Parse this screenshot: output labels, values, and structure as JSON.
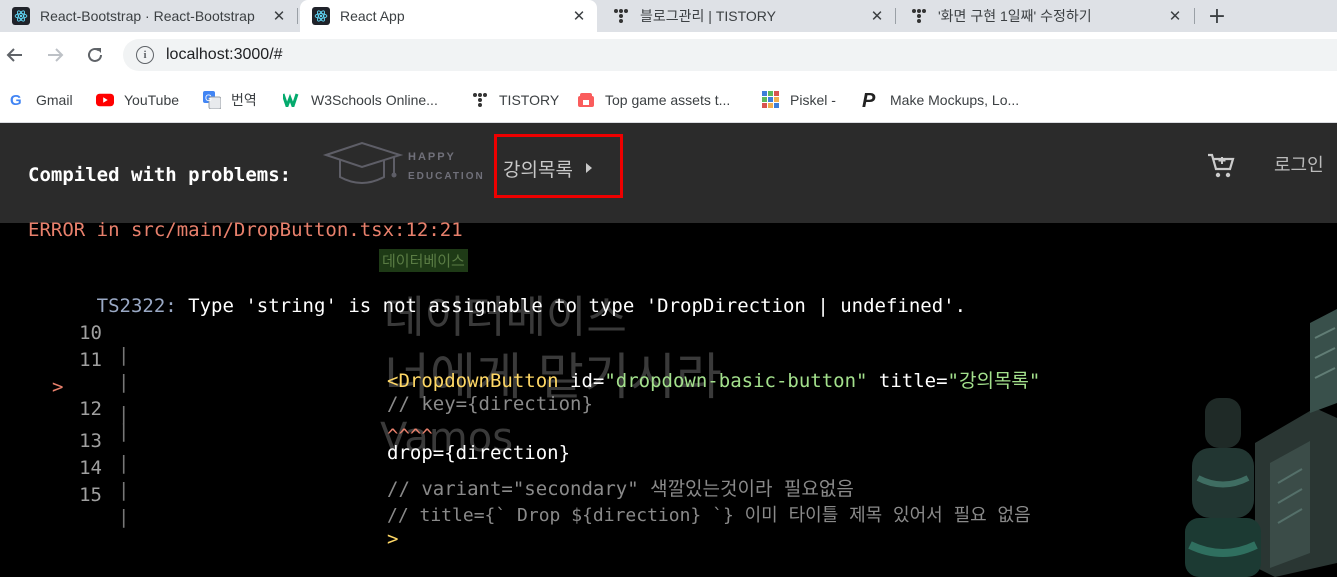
{
  "browser": {
    "tabs": [
      {
        "title": "React-Bootstrap · React-Bootstrap",
        "active": false,
        "icon": "react-icon"
      },
      {
        "title": "React App",
        "active": true,
        "icon": "react-icon"
      },
      {
        "title": "블로그관리 | TISTORY",
        "active": false,
        "icon": "tistory-icon"
      },
      {
        "title": "'화면 구현 1일째' 수정하기",
        "active": false,
        "icon": "tistory-icon"
      }
    ],
    "close_glyph": "✕",
    "new_tab_glyph": "+",
    "url": "localhost:3000/#",
    "bookmarks": [
      {
        "label": "Gmail",
        "icon": "google-icon"
      },
      {
        "label": "YouTube",
        "icon": "youtube-icon"
      },
      {
        "label": "번역",
        "icon": "translate-icon"
      },
      {
        "label": "W3Schools Online...",
        "icon": "w3schools-icon"
      },
      {
        "label": "TISTORY",
        "icon": "tistory-icon"
      },
      {
        "label": "Top game assets t...",
        "icon": "game-assets-icon"
      },
      {
        "label": "Piskel -",
        "icon": "piskel-icon"
      },
      {
        "label": "Make Mockups, Lo...",
        "icon": "mockups-icon"
      }
    ]
  },
  "app": {
    "logo_top": "HAPPY",
    "logo_bottom": "EDUCATION",
    "dropdown_label": "강의목록",
    "login_label": "로그인",
    "highlight_color": "#ee0000",
    "badge": "데이터베이스",
    "ghost_title_1": "데이터베이스",
    "ghost_title_2": "너에게 맡기시라",
    "ghost_sub": "Vamos"
  },
  "overlay": {
    "title": "Compiled with problems:",
    "error_header": "ERROR in src/main/DropButton.tsx:12:21",
    "ts_code": "TS2322:",
    "message": "Type 'string' is not assignable to type 'DropDirection | undefined'.",
    "marker": ">",
    "separator": "|",
    "lines": [
      {
        "num": "10",
        "tag": "<DropdownButton",
        "attr1": " id=",
        "str1": "\"dropdown-basic-button\"",
        "attr2": " title=",
        "str2": "\"강의목록\""
      },
      {
        "num": "11",
        "comment": "// key={direction}"
      },
      {
        "num": "12",
        "code": "drop={direction}",
        "highlighted": true
      },
      {
        "num": "",
        "carets": "^^^^"
      },
      {
        "num": "13",
        "comment": "// variant=\"secondary\" 색깔있는것이라 필요없음"
      },
      {
        "num": "14",
        "comment": "// title={` Drop ${direction} `} 이미 타이틀 제목 있어서 필요 없음"
      },
      {
        "num": "15",
        "tag": ">"
      }
    ]
  }
}
